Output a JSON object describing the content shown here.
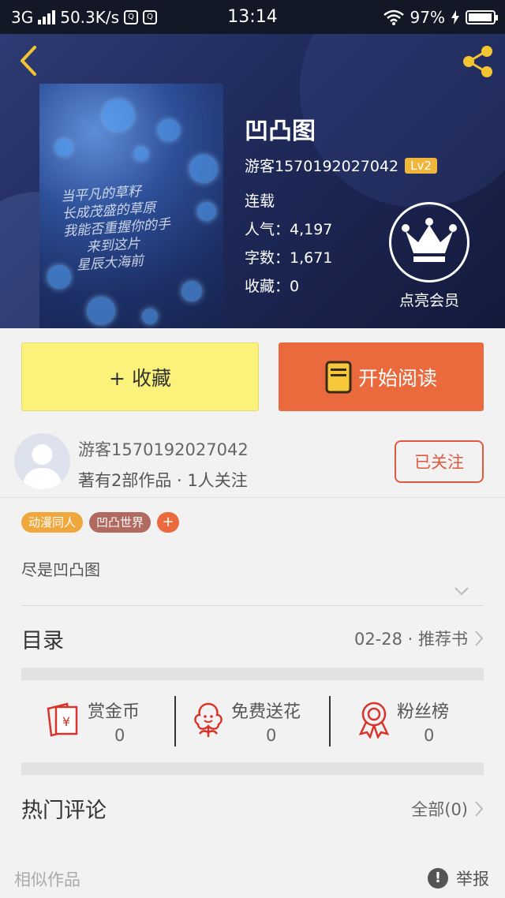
{
  "status_bar": {
    "network": "3G",
    "speed": "50.3K/s",
    "time": "13:14",
    "battery": "97%",
    "battery_level": 0.97
  },
  "book": {
    "title": "凹凸图",
    "author": "游客1570192027042",
    "level": "Lv2",
    "status": "连载",
    "popularity": "人气：4,197",
    "word_count": "字数：1,671",
    "favorites": "收藏：0",
    "cover_poem": [
      "当平凡的草籽",
      "长成茂盛的草原",
      "我能否重握你的手",
      "来到这片",
      "星辰大海前"
    ]
  },
  "vip": {
    "label": "点亮会员"
  },
  "actions": {
    "favorite_label": "+ 收藏",
    "read_label": "开始阅读"
  },
  "author_card": {
    "name": "游客1570192027042",
    "meta": "著有2部作品 · 1人关注",
    "follow_label": "已关注"
  },
  "tags": [
    "动漫同人",
    "凹凸世界",
    "+"
  ],
  "description": "尽是凹凸图",
  "toc": {
    "label": "目录",
    "right": "02-28 · 推荐书"
  },
  "stats": [
    {
      "name": "赏金币",
      "value": "0",
      "icon": "bounty-coin-icon"
    },
    {
      "name": "免费送花",
      "value": "0",
      "icon": "flower-icon"
    },
    {
      "name": "粉丝榜",
      "value": "0",
      "icon": "ribbon-medal-icon"
    }
  ],
  "comments": {
    "label": "热门评论",
    "right": "全部(0)"
  },
  "footer": {
    "similar_label": "相似作品",
    "report_label": "举报"
  },
  "colors": {
    "accent": "#ea6a3e",
    "favorite_bg": "#fbf27c",
    "level_badge": "#f0b63b",
    "hero_bg": "#1f2a5a"
  }
}
